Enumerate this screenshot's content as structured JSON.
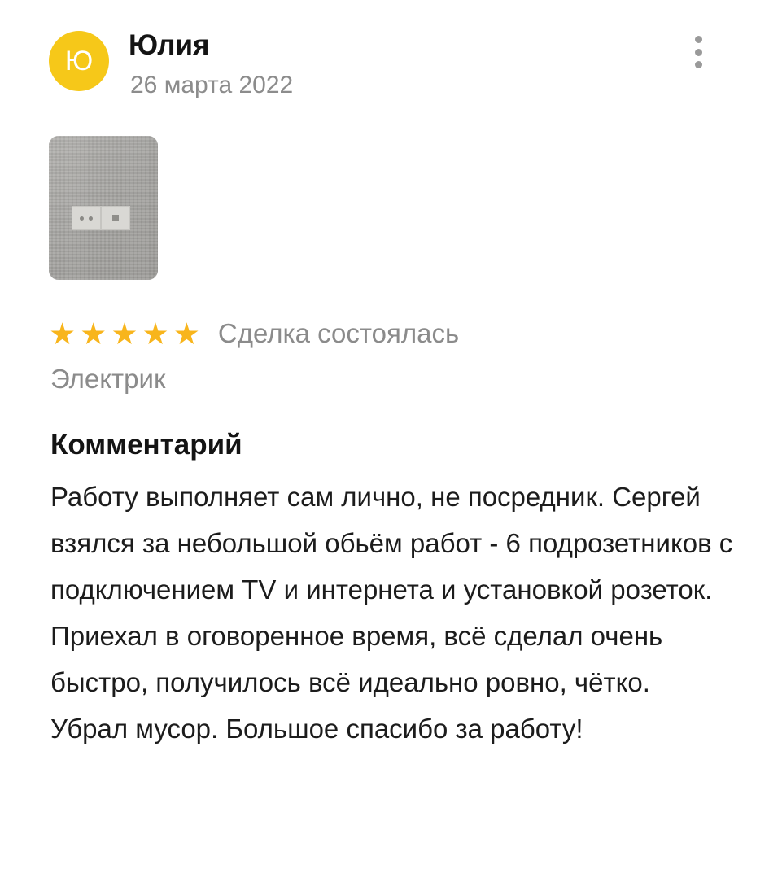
{
  "review": {
    "avatar_letter": "Ю",
    "author": "Юлия",
    "date": "26 марта 2022",
    "more_icon": "more-vertical-icon",
    "rating": 5,
    "rating_max": 5,
    "status": "Сделка состоялась",
    "category": "Электрик",
    "comment_title": "Комментарий",
    "comment_text": "Работу выполняет сам лично, не посредник. Сергей взялся за небольшой обьём работ - 6 подрозетников с подключением TV и интернета и установкой розеток. Приехал в оговоренное время, всё сделал очень быстро, получилось всё идеально ровно, чётко. Убрал мусор. Большое спасибо за работу!"
  },
  "colors": {
    "avatar": "#f6c819",
    "star": "#f8b51c",
    "muted_text": "#8b8b8b"
  }
}
